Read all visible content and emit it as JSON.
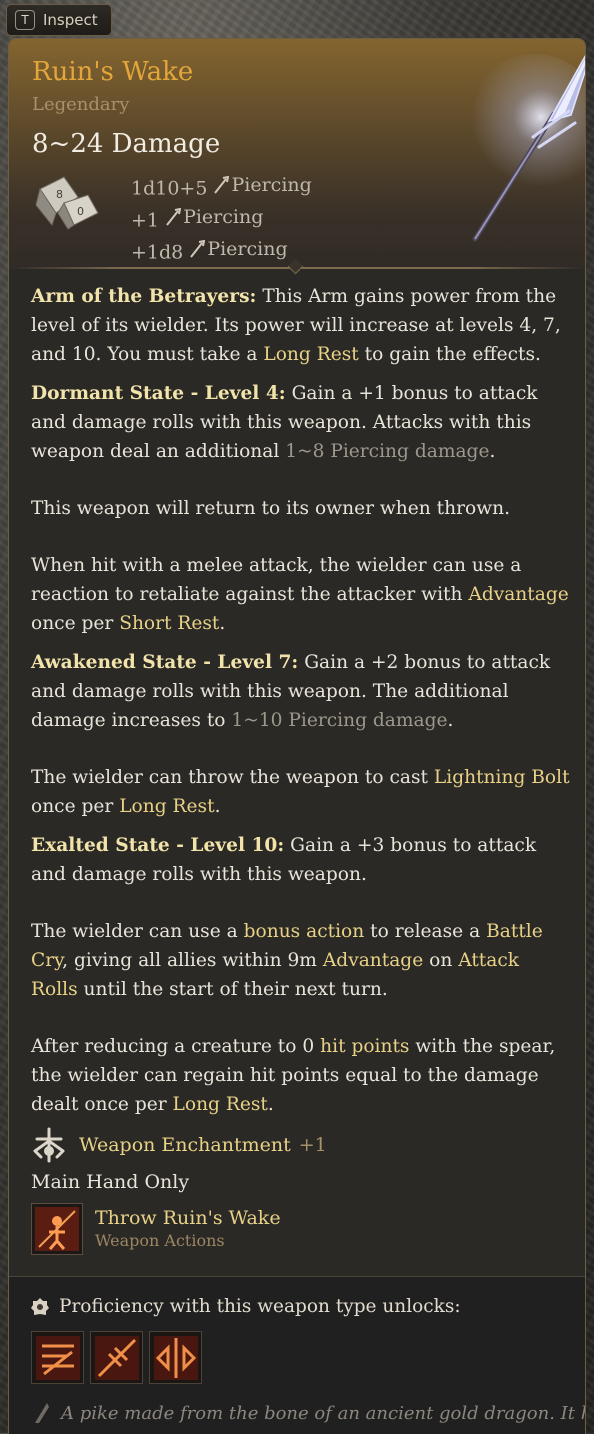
{
  "inspect_tab": {
    "key": "T",
    "label": "Inspect"
  },
  "item": {
    "name": "Ruin's Wake",
    "rarity": "Legendary",
    "damage_total": "8~24 Damage",
    "damage_lines": [
      {
        "amount": "1d10+5",
        "type": "Piercing"
      },
      {
        "amount": "+1",
        "type": "Piercing"
      },
      {
        "amount": "+1d8",
        "type": "Piercing"
      }
    ]
  },
  "description": {
    "p1": {
      "b": "Arm of the Betrayers:",
      "t1": " This Arm gains power from the level of its wielder. Its power will increase at levels 4, 7, and 10. You must take a ",
      "k1": "Long Rest",
      "t2": " to gain the effects."
    },
    "p2": {
      "b": "Dormant State - Level 4:",
      "t1": " Gain a +1 bonus to attack and damage rolls with this weapon. Attacks with this weapon deal an additional ",
      "d1": "1~8 Piercing damage",
      "t2": "."
    },
    "p3": {
      "t1": "This weapon will return to its owner when thrown."
    },
    "p4": {
      "t1": "When hit with a melee attack, the wielder can use a reaction to retaliate against the attacker with ",
      "k1": "Advantage",
      "t2": " once per ",
      "k2": "Short Rest",
      "t3": "."
    },
    "p5": {
      "b": "Awakened State - Level 7:",
      "t1": " Gain a +2 bonus to attack and damage rolls with this weapon. The additional damage increases to ",
      "d1": "1~10 Piercing damage",
      "t2": "."
    },
    "p6": {
      "t1": "The wielder can throw the weapon to cast ",
      "k1": "Lightning Bolt",
      "t2": " once per ",
      "k2": "Long Rest",
      "t3": "."
    },
    "p7": {
      "b": "Exalted State - Level 10:",
      "t1": " Gain a +3 bonus to attack and damage rolls with this weapon."
    },
    "p8": {
      "t1": "The wielder can use a ",
      "k1": "bonus action",
      "t2": " to release a ",
      "k2": "Battle Cry",
      "t3": ", giving all allies within 9m ",
      "k3": "Advantage",
      "t4": " on ",
      "k4": "Attack Rolls",
      "t5": " until the start of their next turn."
    },
    "p9": {
      "t1": "After reducing a creature to 0 ",
      "k1": "hit points",
      "t2": " with the spear, the wielder can regain hit points equal to the damage dealt once per ",
      "k2": "Long Rest",
      "t3": "."
    }
  },
  "enchantment": {
    "label": "Weapon Enchantment",
    "bonus": "+1"
  },
  "restriction": "Main Hand Only",
  "weapon_action": {
    "name": "Throw Ruin's Wake",
    "category": "Weapon Actions"
  },
  "proficiency": {
    "label": "Proficiency with this weapon type unlocks:",
    "icons": [
      "weapon-action-icon",
      "weapon-action-icon",
      "weapon-action-icon"
    ]
  },
  "flavor": "A pike made from the bone of an ancient gold dragon. It has a",
  "colors": {
    "title": "#e3a63b",
    "keyword": "#e8d287",
    "rarity": "#a8906a",
    "panel": "#2b2926"
  }
}
